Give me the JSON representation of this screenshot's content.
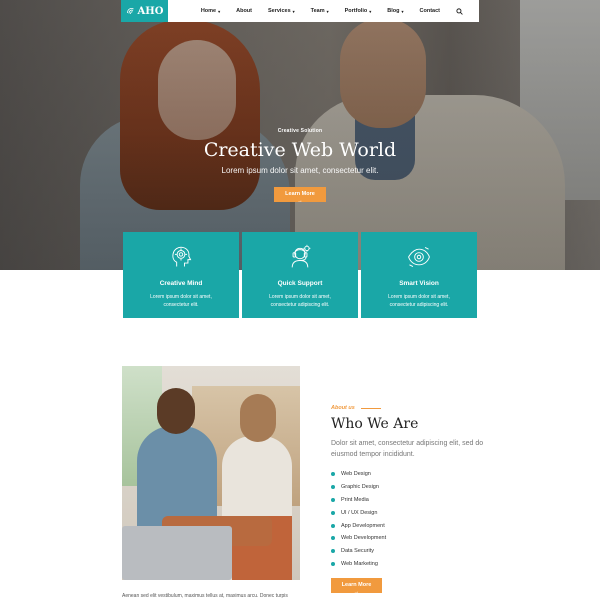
{
  "nav": {
    "logo_text": "AHO",
    "items": [
      {
        "label": "Home",
        "caret": "▾"
      },
      {
        "label": "About",
        "caret": ""
      },
      {
        "label": "Services",
        "caret": "▾"
      },
      {
        "label": "Team",
        "caret": "▾"
      },
      {
        "label": "Portfolio",
        "caret": "▾"
      },
      {
        "label": "Blog",
        "caret": "▾"
      },
      {
        "label": "Contact",
        "caret": ""
      }
    ],
    "search_icon": "search-icon"
  },
  "hero": {
    "kicker": "Creative Solution",
    "title": "Creative Web World",
    "subtitle": "Lorem ipsum dolor sit amet, consectetur elit.",
    "button": "Learn More →"
  },
  "features": [
    {
      "icon": "mind-icon",
      "title": "Creative Mind",
      "line1": "Lorem ipsum dolor sit amet,",
      "line2": "consectetur elit."
    },
    {
      "icon": "support-icon",
      "title": "Quick Support",
      "line1": "Lorem ipsum dolor sit amet,",
      "line2": "consectetur adipiscing elit."
    },
    {
      "icon": "vision-icon",
      "title": "Smart Vision",
      "line1": "Lorem ipsum dolor sit amet,",
      "line2": "consectetur adipiscing elit."
    }
  ],
  "about": {
    "kicker": "About us",
    "title": "Who We Are",
    "description": "Dolor sit amet, consectetur adipiscing elit, sed do eiusmod tempor incididunt.",
    "services": [
      "Web Design",
      "Graphic Design",
      "Print Media",
      "UI / UX Design",
      "App Development",
      "Web Development",
      "Data Security",
      "Web Marketing"
    ],
    "button": "Learn More →",
    "caption": "Aenean sed elit vestibulum, maximus tellus at, maximus arcu. Donec turpis"
  },
  "colors": {
    "accent": "#1aa7a7",
    "button": "#f19a3e"
  }
}
